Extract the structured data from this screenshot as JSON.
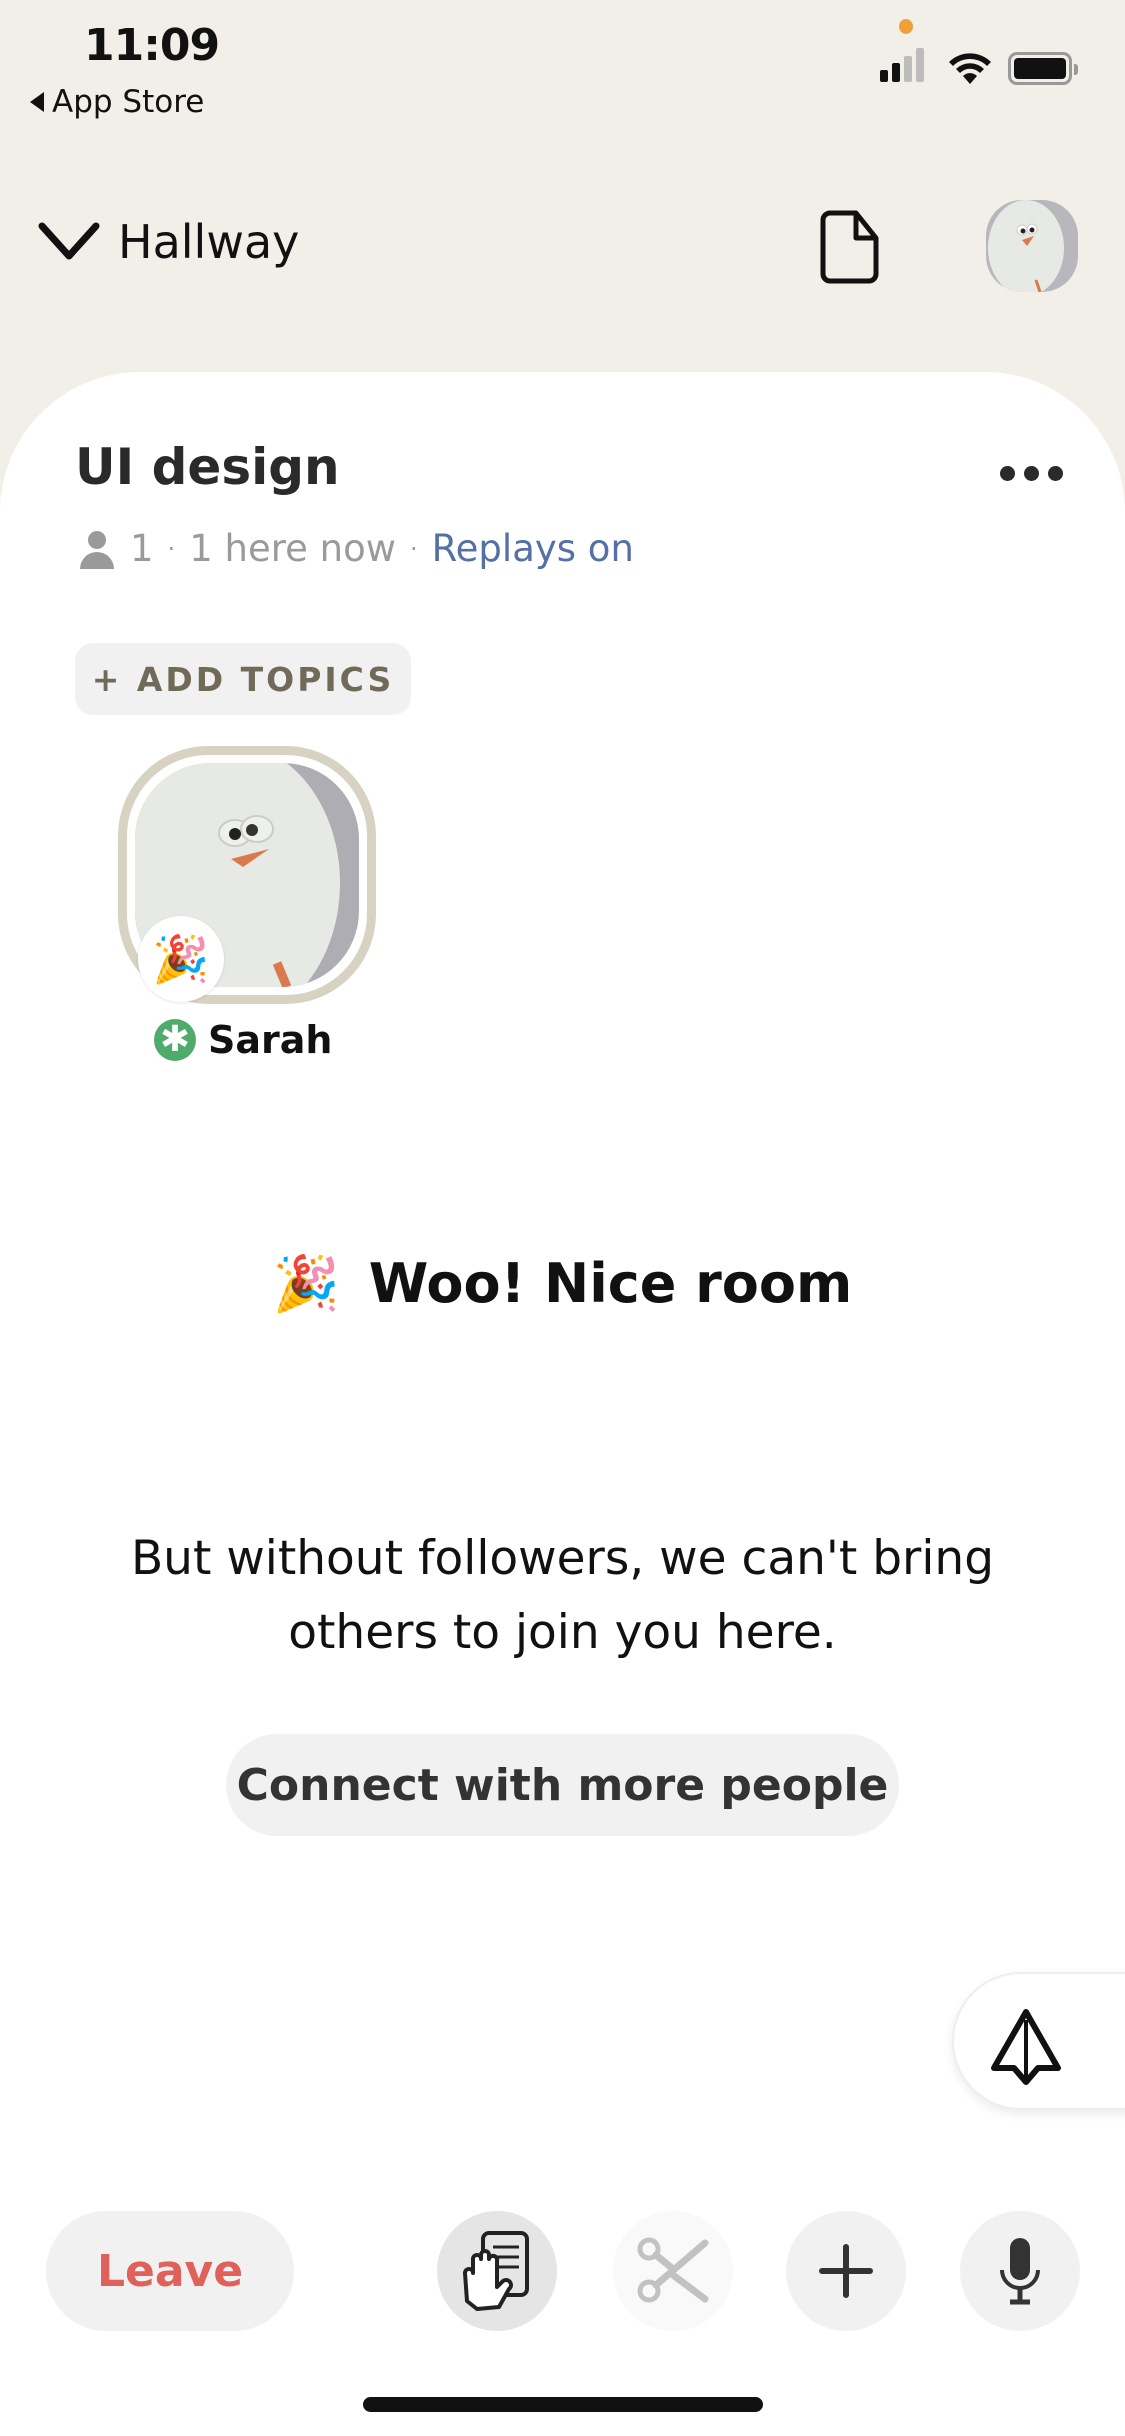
{
  "status_bar": {
    "time": "11:09",
    "back_label": "App Store",
    "privacy_indicator_color": "#f0a03a"
  },
  "header": {
    "room_group": "Hallway",
    "chevron_icon": "chevron-down-icon",
    "doc_icon": "document-icon",
    "avatar_icon": "profile-avatar"
  },
  "room": {
    "title": "UI design",
    "member_count": "1",
    "here_now": "1 here now",
    "replays": "Replays on",
    "add_topics": "+ ADD TOPICS"
  },
  "speakers": [
    {
      "name": "Sarah",
      "badge_emoji": "🎉",
      "moderator_badge": "✱"
    }
  ],
  "empty_state": {
    "emoji": "🎉",
    "title": "Woo! Nice room",
    "message": "But without followers, we can't bring others to join you here.",
    "button": "Connect with more people"
  },
  "share_button": {
    "icon": "paper-plane-icon"
  },
  "bottom_bar": {
    "leave": "Leave",
    "raise_hand_icon": "raise-hand-icon",
    "clip_icon": "scissors-icon",
    "add_icon": "plus-icon",
    "mic_icon": "microphone-icon"
  },
  "colors": {
    "background": "#f1efe7",
    "accent_link": "#5470a6",
    "leave_red": "#e0605a",
    "moderator_green": "#4fab6c",
    "topic_text": "#716a58"
  }
}
